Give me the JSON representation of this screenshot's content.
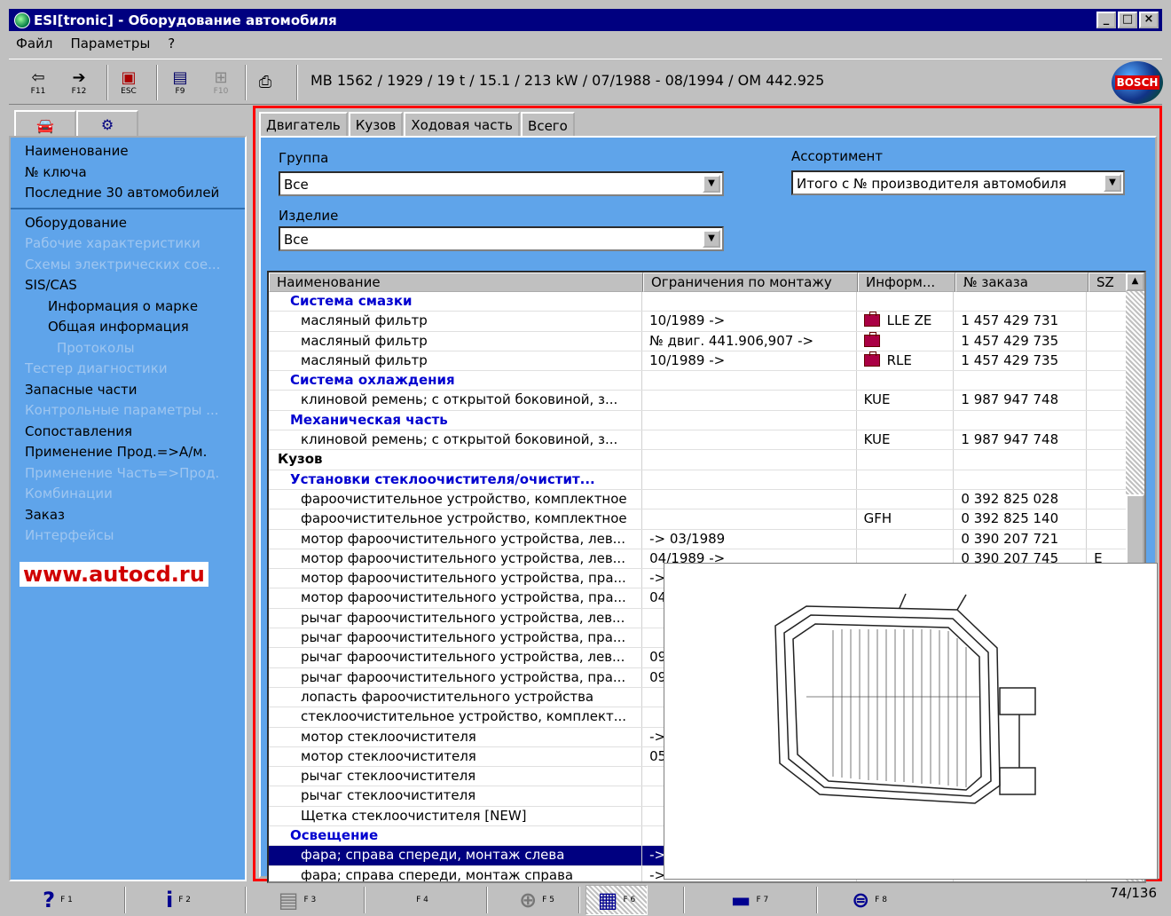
{
  "window": {
    "title": "ESI[tronic] - Оборудование автомобиля",
    "buttons": [
      "_",
      "□",
      "×"
    ]
  },
  "menu": [
    "Файл",
    "Параметры",
    "?"
  ],
  "toolbar": {
    "buttons": [
      {
        "icon": "arrow-left-icon",
        "key": "F11"
      },
      {
        "icon": "arrow-right-icon",
        "key": "F12"
      },
      {
        "icon": "esc-icon",
        "key": "ESC"
      },
      {
        "icon": "list-icon",
        "key": "F9"
      },
      {
        "icon": "tree-icon",
        "key": "F10"
      },
      {
        "icon": "printer-icon",
        "key": ""
      }
    ],
    "vehicle_info": "MB 1562 / 1929 / 19 t / 15.1 / 213 kW / 07/1988 - 08/1994 / OM 442.925",
    "logo_text": "BOSCH"
  },
  "left": {
    "tabs": [
      "car-icon",
      "engine-icon"
    ],
    "section1": [
      "Наименование",
      "№ ключа",
      "Последние 30 автомобилей"
    ],
    "section2": [
      {
        "label": "Оборудование",
        "enabled": true,
        "indent": 0
      },
      {
        "label": "Рабочие характеристики",
        "enabled": false,
        "indent": 0
      },
      {
        "label": "Схемы электрических сое...",
        "enabled": false,
        "indent": 0
      },
      {
        "label": "SIS/CAS",
        "enabled": true,
        "indent": 0
      },
      {
        "label": "Информация о марке",
        "enabled": true,
        "indent": 1
      },
      {
        "label": "Общая информация",
        "enabled": true,
        "indent": 1
      },
      {
        "label": "Протоколы",
        "enabled": false,
        "indent": 2
      },
      {
        "label": "Тестер диагностики",
        "enabled": false,
        "indent": 0
      },
      {
        "label": "Запасные части",
        "enabled": true,
        "indent": 0
      },
      {
        "label": "Контрольные параметры ...",
        "enabled": false,
        "indent": 0
      },
      {
        "label": "Сопоставления",
        "enabled": true,
        "indent": 0
      },
      {
        "label": "Применение Прод.=>А/м.",
        "enabled": true,
        "indent": 0
      },
      {
        "label": "Применение Часть=>Прод.",
        "enabled": false,
        "indent": 0
      },
      {
        "label": "Комбинации",
        "enabled": false,
        "indent": 0
      },
      {
        "label": "Заказ",
        "enabled": true,
        "indent": 0
      },
      {
        "label": "Интерфейсы",
        "enabled": false,
        "indent": 0
      }
    ],
    "watermark": "www.autocd.ru"
  },
  "main": {
    "tabs": [
      "Двигатель",
      "Кузов",
      "Ходовая часть",
      "Всего"
    ],
    "active_tab": 3,
    "group_label": "Группа",
    "group_value": "Все",
    "product_label": "Изделие",
    "product_value": "Все",
    "assortment_label": "Ассортимент",
    "assortment_value": "Итого с № производителя автомобиля"
  },
  "grid": {
    "columns": [
      "Наименование",
      "Ограничения по монтажу",
      "Информ...",
      "№ заказа",
      "SZ"
    ],
    "rows": [
      {
        "type": "group",
        "name": "Система смазки",
        "limit": "",
        "info": "",
        "info_icon": false,
        "order": "",
        "sz": ""
      },
      {
        "type": "item",
        "name": "масляный фильтр",
        "limit": "10/1989 ->",
        "info": "LLE ZE",
        "info_icon": true,
        "order": "1 457 429 731",
        "sz": ""
      },
      {
        "type": "item",
        "name": "масляный фильтр",
        "limit": "№ двиг. 441.906,907 ->",
        "info": "",
        "info_icon": true,
        "order": "1 457 429 735",
        "sz": ""
      },
      {
        "type": "item",
        "name": "масляный фильтр",
        "limit": "10/1989 ->",
        "info": "RLE",
        "info_icon": true,
        "order": "1 457 429 735",
        "sz": ""
      },
      {
        "type": "group",
        "name": "Система охлаждения",
        "limit": "",
        "info": "",
        "info_icon": false,
        "order": "",
        "sz": ""
      },
      {
        "type": "item",
        "name": "клиновой ремень; с открытой боковиной, з...",
        "limit": "",
        "info": "KUE",
        "info_icon": false,
        "order": "1 987 947 748",
        "sz": ""
      },
      {
        "type": "group",
        "name": "Механическая часть",
        "limit": "",
        "info": "",
        "info_icon": false,
        "order": "",
        "sz": ""
      },
      {
        "type": "item",
        "name": "клиновой ремень; с открытой боковиной, з...",
        "limit": "",
        "info": "KUE",
        "info_icon": false,
        "order": "1 987 947 748",
        "sz": ""
      },
      {
        "type": "cat",
        "name": "Кузов",
        "limit": "",
        "info": "",
        "info_icon": false,
        "order": "",
        "sz": ""
      },
      {
        "type": "group",
        "name": "Установки стеклоочистителя/очистит...",
        "limit": "",
        "info": "",
        "info_icon": false,
        "order": "",
        "sz": ""
      },
      {
        "type": "item",
        "name": "фароочистительное устройство, комплектное",
        "limit": "",
        "info": "",
        "info_icon": false,
        "order": "0 392 825 028",
        "sz": ""
      },
      {
        "type": "item",
        "name": "фароочистительное устройство, комплектное",
        "limit": "",
        "info": "GFH",
        "info_icon": false,
        "order": "0 392 825 140",
        "sz": ""
      },
      {
        "type": "item",
        "name": "мотор фароочистительного устройства, лев...",
        "limit": "-> 03/1989",
        "info": "",
        "info_icon": false,
        "order": "0 390 207 721",
        "sz": ""
      },
      {
        "type": "item",
        "name": "мотор фароочистительного устройства, лев...",
        "limit": "04/1989 ->",
        "info": "",
        "info_icon": false,
        "order": "0 390 207 745",
        "sz": "E"
      },
      {
        "type": "item",
        "name": "мотор фароочистительного устройства, пра...",
        "limit": "->",
        "info": "",
        "info_icon": false,
        "order": "",
        "sz": ""
      },
      {
        "type": "item",
        "name": "мотор фароочистительного устройства, пра...",
        "limit": "04",
        "info": "",
        "info_icon": false,
        "order": "",
        "sz": ""
      },
      {
        "type": "item",
        "name": "рычаг фароочистительного устройства, лев...",
        "limit": "",
        "info": "",
        "info_icon": false,
        "order": "",
        "sz": ""
      },
      {
        "type": "item",
        "name": "рычаг фароочистительного устройства, пра...",
        "limit": "",
        "info": "",
        "info_icon": false,
        "order": "",
        "sz": ""
      },
      {
        "type": "item",
        "name": "рычаг фароочистительного устройства, лев...",
        "limit": "09",
        "info": "",
        "info_icon": false,
        "order": "",
        "sz": ""
      },
      {
        "type": "item",
        "name": "рычаг фароочистительного устройства, пра...",
        "limit": "09",
        "info": "",
        "info_icon": false,
        "order": "",
        "sz": ""
      },
      {
        "type": "item",
        "name": "лопасть фароочистительного устройства",
        "limit": "",
        "info": "",
        "info_icon": false,
        "order": "",
        "sz": ""
      },
      {
        "type": "item",
        "name": "стеклоочистительное устройство, комплект...",
        "limit": "",
        "info": "",
        "info_icon": false,
        "order": "",
        "sz": ""
      },
      {
        "type": "item",
        "name": "мотор стеклоочистителя",
        "limit": "->",
        "info": "",
        "info_icon": false,
        "order": "",
        "sz": ""
      },
      {
        "type": "item",
        "name": "мотор стеклоочистителя",
        "limit": "05",
        "info": "",
        "info_icon": false,
        "order": "",
        "sz": ""
      },
      {
        "type": "item",
        "name": "рычаг стеклоочистителя",
        "limit": "",
        "info": "",
        "info_icon": false,
        "order": "",
        "sz": ""
      },
      {
        "type": "item",
        "name": "рычаг стеклоочистителя",
        "limit": "",
        "info": "",
        "info_icon": false,
        "order": "",
        "sz": ""
      },
      {
        "type": "item",
        "name": "Щетка стеклоочистителя [NEW]",
        "limit": "",
        "info": "",
        "info_icon": false,
        "order": "",
        "sz": ""
      },
      {
        "type": "group",
        "name": "Освещение",
        "limit": "",
        "info": "",
        "info_icon": false,
        "order": "",
        "sz": ""
      },
      {
        "type": "item sel",
        "name": "фара; справа спереди, монтаж слева",
        "limit": "->",
        "info": "",
        "info_icon": false,
        "order": "",
        "sz": ""
      },
      {
        "type": "item",
        "name": "фара; справа спереди, монтаж справа",
        "limit": "->",
        "info": "",
        "info_icon": false,
        "order": "",
        "sz": ""
      }
    ]
  },
  "bottom": {
    "buttons": [
      {
        "icon": "help-icon",
        "glyph": "?",
        "key": "F 1"
      },
      {
        "icon": "info-icon",
        "glyph": "i",
        "key": "F 2"
      },
      {
        "icon": "calculator-icon",
        "glyph": "▤",
        "key": "F 3"
      },
      {
        "icon": "blank-icon",
        "glyph": "",
        "key": "F 4"
      },
      {
        "icon": "zoom-icon",
        "glyph": "⊕",
        "key": "F 5"
      },
      {
        "icon": "parts-list-icon",
        "glyph": "▦",
        "key": "F 6"
      },
      {
        "icon": "car-icon",
        "glyph": "▬",
        "key": "F 7"
      },
      {
        "icon": "bosch-logo-icon",
        "glyph": "⊜",
        "key": "F 8"
      }
    ],
    "counter": "74/136"
  },
  "colors": {
    "titlebar": "#000080",
    "panel_blue": "#5fa4ea",
    "group_text": "#0000d0",
    "selection": "#000080",
    "frame_red": "#ff0000"
  }
}
